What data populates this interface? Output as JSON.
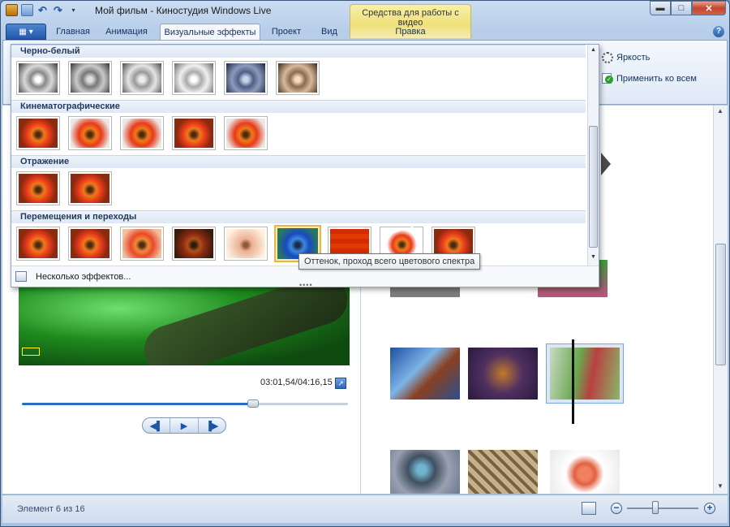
{
  "window": {
    "title": "Мой фильм - Киностудия Windows Live",
    "context_tab_group": "Средства для работы с видео",
    "buttons": {
      "minimize": "▬",
      "maximize": "□",
      "close": "✕"
    }
  },
  "quick_access": {
    "undo": "↶",
    "redo": "↷",
    "dropdown": "▾"
  },
  "tabs": {
    "app_menu": "▾",
    "items": [
      "Главная",
      "Анимация",
      "Визуальные эффекты",
      "Проект",
      "Вид",
      "Правка"
    ],
    "active": "Визуальные эффекты",
    "help": "?"
  },
  "ribbon": {
    "brightness": "Яркость",
    "apply_all": "Применить ко всем"
  },
  "gallery": {
    "sections": [
      {
        "title": "Черно-белый",
        "count": 6
      },
      {
        "title": "Кинематографические",
        "count": 5
      },
      {
        "title": "Отражение",
        "count": 2
      },
      {
        "title": "Перемещения и переходы",
        "count": 9
      }
    ],
    "hovered_effect_tooltip": "Оттенок, проход всего цветового спектра",
    "footer_label": "Несколько эффектов...",
    "resize_grip": "••••"
  },
  "preview": {
    "time": "03:01,54/04:16,15",
    "position_fraction": 0.71,
    "fullscreen_icon": "↗",
    "controls": {
      "prev": "◀▌",
      "play": "▶",
      "next": "▐▶"
    }
  },
  "status_bar": {
    "item_count": "Элемент 6 из 16",
    "zoom_minus": "−",
    "zoom_plus": "+",
    "zoom_fraction": 0.4
  }
}
